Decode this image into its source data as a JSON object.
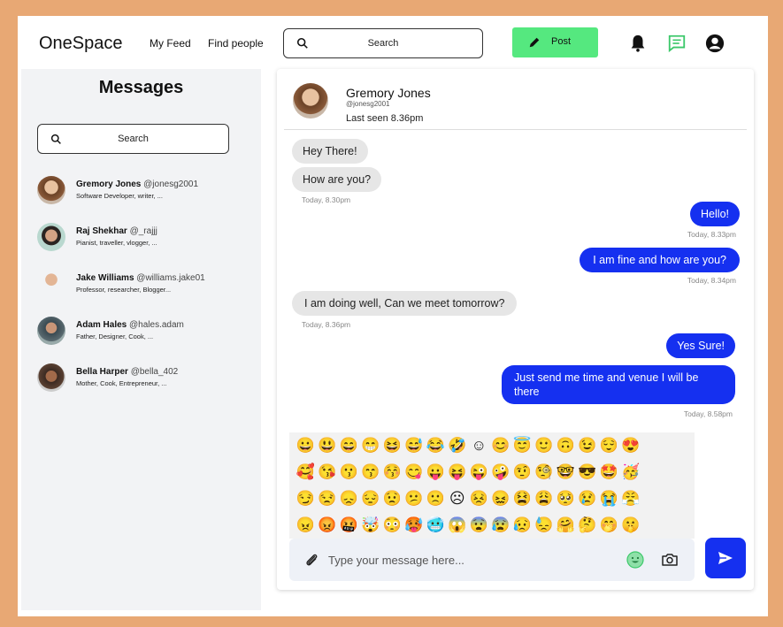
{
  "header": {
    "logo": "OneSpace",
    "nav": [
      "My Feed",
      "Find people"
    ],
    "search_placeholder": "Search",
    "post_label": "Post",
    "icons": [
      "bell-icon",
      "chat-icon",
      "profile-icon"
    ],
    "accent": "#55e87f"
  },
  "sidebar": {
    "title": "Messages",
    "search_placeholder": "Search",
    "contacts": [
      {
        "name": "Gremory Jones",
        "handle": "@jonesg2001",
        "desc": "Software Developer, writer, ..."
      },
      {
        "name": "Raj Shekhar",
        "handle": "@_rajjj",
        "desc": "Pianist, traveller, vlogger, ..."
      },
      {
        "name": "Jake Williams",
        "handle": "@williams.jake01",
        "desc": "Professor, researcher, Blogger..."
      },
      {
        "name": "Adam Hales",
        "handle": "@hales.adam",
        "desc": "Father, Designer, Cook, ..."
      },
      {
        "name": "Bella Harper",
        "handle": "@bella_402",
        "desc": "Mother, Cook, Entrepreneur, ..."
      }
    ]
  },
  "chat": {
    "name": "Gremory Jones",
    "handle": "@jonesg2001",
    "last_seen": "Last seen 8.36pm",
    "messages": [
      {
        "text": "Hey There!",
        "dir": "in"
      },
      {
        "text": "How are you?",
        "dir": "in"
      },
      {
        "stamp": "Today, 8.30pm"
      },
      {
        "text": "Hello!",
        "dir": "out"
      },
      {
        "stamp": "Today, 8.33pm"
      },
      {
        "text": "I am fine and how are you?",
        "dir": "out"
      },
      {
        "stamp": "Today, 8.34pm"
      },
      {
        "text": "I am doing well, Can we meet tomorrow?",
        "dir": "in"
      },
      {
        "stamp": "Today, 8.36pm"
      },
      {
        "text": "Yes Sure!",
        "dir": "out"
      },
      {
        "text": "Just send me time and venue I will be there",
        "dir": "out"
      },
      {
        "stamp": "Today, 8.58pm"
      }
    ],
    "emoji_rows": [
      "😀😃😄😁😆😅😂🤣☺️😊😇🙂🙃😉😌😍",
      "🥰😘😗😙😚😋😛😝😜🤪🤨🧐🤓😎🤩🥳",
      "😏😒😞😔😟😕🙁☹️😣😖😫😩🥺😢😭😤",
      "😠😡🤬🤯😳🥵🥶😱😨😰😥😓🤗🤔🤭🤫"
    ],
    "composer_placeholder": "Type your message here...",
    "send_color": "#1530f0"
  }
}
